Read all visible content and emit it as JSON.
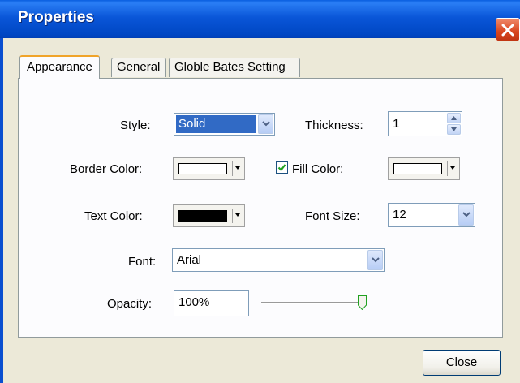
{
  "window": {
    "title": "Properties"
  },
  "tabs": [
    {
      "label": "Appearance",
      "active": true
    },
    {
      "label": "General",
      "active": false
    },
    {
      "label": "Globle Bates Setting",
      "active": false
    }
  ],
  "appearance": {
    "style": {
      "label": "Style:",
      "value": "Solid"
    },
    "thickness": {
      "label": "Thickness:",
      "value": "1"
    },
    "border_color": {
      "label": "Border Color:",
      "swatch": "#ffffff"
    },
    "fill_color": {
      "label": "Fill Color:",
      "checked": true,
      "swatch": "#ffffff"
    },
    "text_color": {
      "label": "Text Color:",
      "swatch": "#000000"
    },
    "font_size": {
      "label": "Font Size:",
      "value": "12"
    },
    "font": {
      "label": "Font:",
      "value": "Arial"
    },
    "opacity": {
      "label": "Opacity:",
      "value": "100%",
      "slider_fraction": 1.0
    }
  },
  "buttons": {
    "close": "Close"
  },
  "icons": {
    "window_close": "close-x-icon",
    "dropdown": "chevron-down-icon",
    "spinner_up": "triangle-up-icon",
    "spinner_down": "triangle-down-icon",
    "checkbox": "checkmark-icon"
  },
  "colors": {
    "titlebar": "#0a56d8",
    "selection": "#316ac5",
    "close_button_red": "#d8461f",
    "active_tab_accent": "#f0a42a"
  }
}
